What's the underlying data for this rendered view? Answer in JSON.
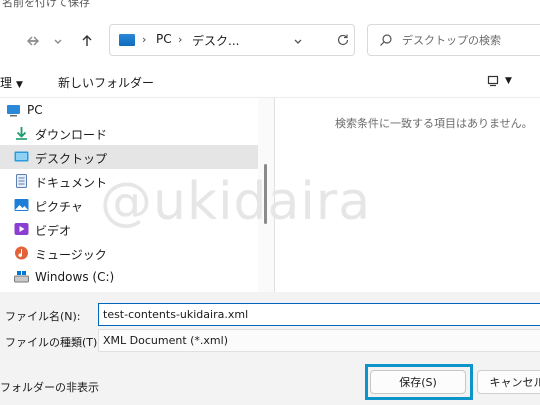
{
  "window": {
    "title": "名前を付けて保存"
  },
  "nav": {
    "back_icon": "arrow-left-icon",
    "forward_icon": "arrow-right-icon",
    "recent_icon": "chevron-down-icon",
    "up_icon": "arrow-up-icon"
  },
  "address": {
    "segments": [
      "PC",
      "デスク..."
    ],
    "separator": "›"
  },
  "search": {
    "placeholder": "デスクトップの検索"
  },
  "toolbar": {
    "organize_label": "整理",
    "new_folder_label": "新しいフォルダー"
  },
  "sidebar": {
    "items": [
      {
        "label": "PC",
        "icon": "pc-icon"
      },
      {
        "label": "ダウンロード",
        "icon": "download-icon"
      },
      {
        "label": "デスクトップ",
        "icon": "desktop-icon",
        "selected": true
      },
      {
        "label": "ドキュメント",
        "icon": "document-icon"
      },
      {
        "label": "ピクチャ",
        "icon": "pictures-icon"
      },
      {
        "label": "ビデオ",
        "icon": "video-icon"
      },
      {
        "label": "ミュージック",
        "icon": "music-icon"
      },
      {
        "label": "Windows (C:)",
        "icon": "drive-icon"
      }
    ]
  },
  "content": {
    "empty_message": "検索条件に一致する項目はありません。"
  },
  "watermark": "@ukidaira",
  "form": {
    "filename_label": "ファイル名(N):",
    "filename_value": "test-contents-ukidaira.xml",
    "filetype_label": "ファイルの種類(T):",
    "filetype_value": "XML Document (*.xml)"
  },
  "footer": {
    "hide_folders_label": "フォルダーの非表示",
    "save_label": "保存(S)",
    "cancel_label": "キャンセル"
  },
  "colors": {
    "highlight": "#0d95c9",
    "selected_row": "#e5e5e5",
    "accent": "#0067c0"
  }
}
